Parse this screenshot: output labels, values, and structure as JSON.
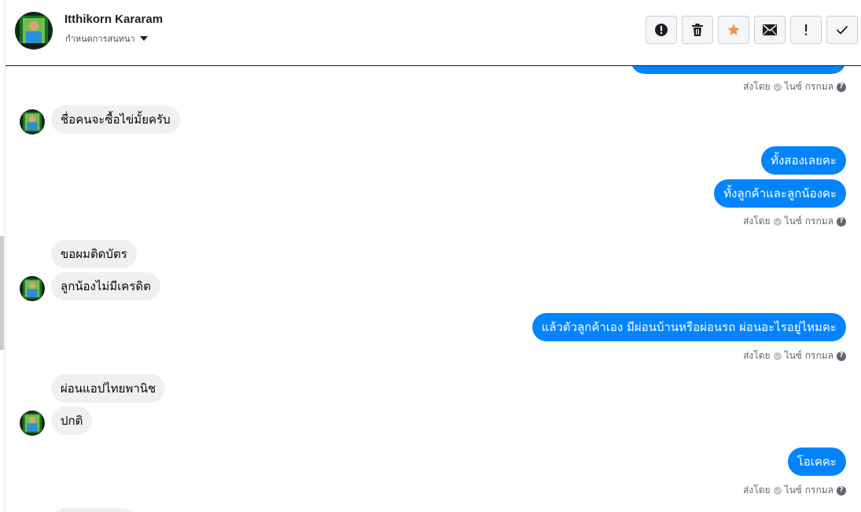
{
  "header": {
    "name": "Itthikorn Kararam",
    "subtitle": "กำหนดการสนทนา",
    "actions": [
      {
        "name": "report-button",
        "icon": "alert-circle-icon"
      },
      {
        "name": "delete-button",
        "icon": "trash-icon"
      },
      {
        "name": "star-button",
        "icon": "star-icon"
      },
      {
        "name": "mark-unread-button",
        "icon": "envelope-icon"
      },
      {
        "name": "follow-up-button",
        "icon": "exclamation-icon"
      },
      {
        "name": "mark-done-button",
        "icon": "checkmark-icon"
      }
    ]
  },
  "status_text": {
    "sent_by": "ส่งโดย",
    "sender": "ไนซ์ กรกมล"
  },
  "messages": {
    "m1": "ชื่อคนจะซื้อไข่มั้ยครับ",
    "m2": "ทั้งสองเลยคะ",
    "m3": "ทั้งลูกค้าและลูกน้องคะ",
    "m4": "ขอผมติดบัตร",
    "m5": "ลูกน้องไม่มีเครดิต",
    "m6": "แล้วตัวลูกค้าเอง มีผ่อนบ้านหรือผ่อนรถ ผ่อนอะไรอยู่ไหมคะ",
    "m7": "ผ่อนแอปไทยพานิช",
    "m8": "ปกติ",
    "m9": "โอเคคะ"
  },
  "colors": {
    "outgoing_bubble": "#0084ff",
    "incoming_bubble": "#f0f0f0",
    "star_active": "#f7923b"
  }
}
